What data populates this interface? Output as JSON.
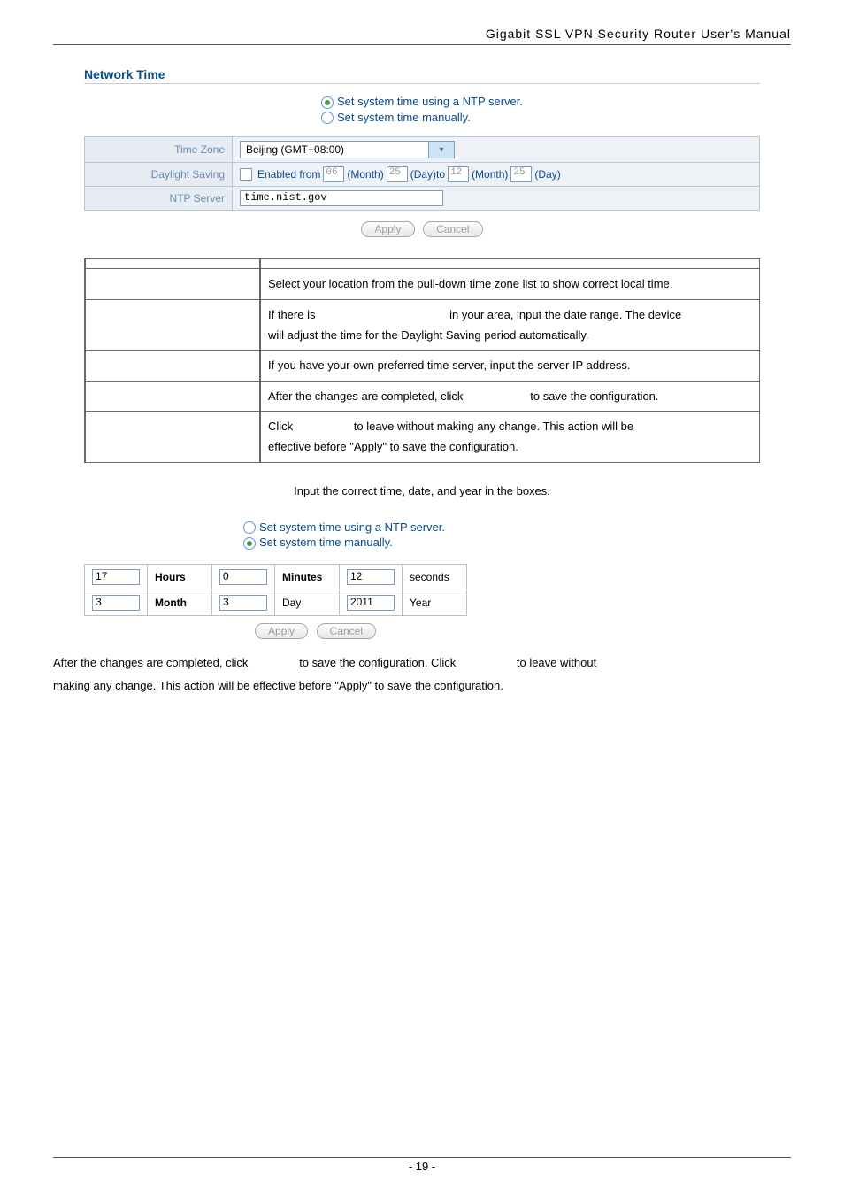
{
  "header": {
    "title": "Gigabit  SSL  VPN  Security  Router  User's  Manual"
  },
  "section_title": "Network Time",
  "radio": {
    "ntp": "Set system time using a NTP server.",
    "manual": "Set system time manually."
  },
  "config": {
    "labels": {
      "tz": "Time Zone",
      "dls": "Daylight Saving",
      "ntp": "NTP Server"
    },
    "tz_value": "Beijing (GMT+08:00)",
    "dls": {
      "enabled": "Enabled  from",
      "m1": "06",
      "month1_lbl": "(Month)",
      "d1": "25",
      "day1_lbl": "(Day)to",
      "m2": "12",
      "month2_lbl": "(Month)",
      "d2": "25",
      "day2_lbl": "(Day)"
    },
    "ntp_value": "time.nist.gov"
  },
  "buttons": {
    "apply": "Apply",
    "cancel": "Cancel"
  },
  "desc": {
    "tz": "Select your location from the pull-down time zone list to show correct local time.",
    "dls1": "If there is",
    "dls2": "in your area, input the date range. The device",
    "dls3": "will adjust the time for the Daylight Saving period automatically.",
    "ntp": "If you have your own preferred time server, input the server IP address.",
    "apply1": "After the changes are completed, click",
    "apply2": "to save the configuration.",
    "cancel1": "Click",
    "cancel2": "to leave without making any change. This action will be",
    "cancel3": "effective before \"Apply\" to save the configuration."
  },
  "manual_note": "Input the correct time, date, and year in the boxes.",
  "manual_time": {
    "h": "17",
    "h_lbl": "Hours",
    "mi": "0",
    "mi_lbl": "Minutes",
    "s": "12",
    "s_lbl": "seconds",
    "mo": "3",
    "mo_lbl": "Month",
    "d": "3",
    "d_lbl": "Day",
    "y": "2011",
    "y_lbl": "Year"
  },
  "closing1": "After the changes are completed, click",
  "closing2": "to save the configuration. Click",
  "closing3": "to leave without",
  "closing4": "making any change. This action will be effective before \"Apply\" to save the configuration.",
  "page_number": "- 19 -"
}
